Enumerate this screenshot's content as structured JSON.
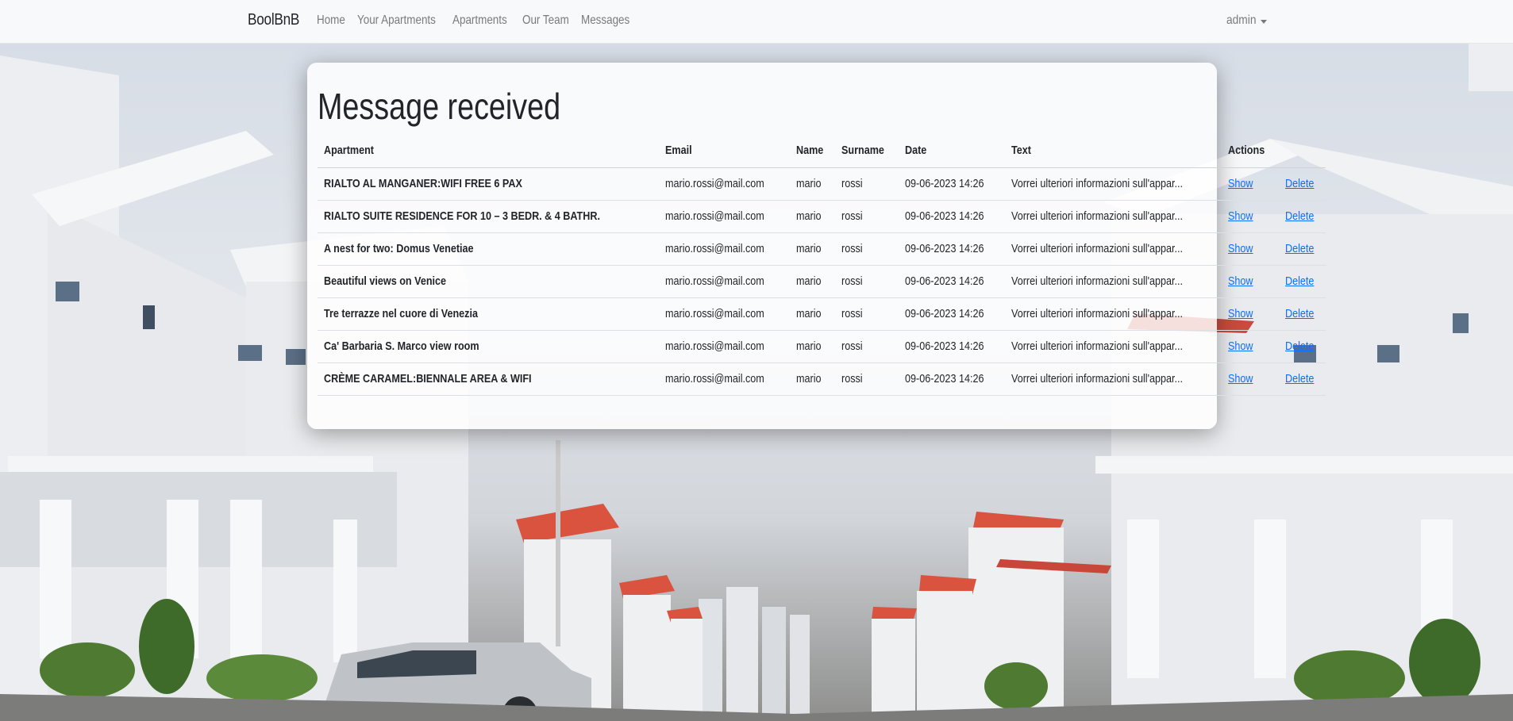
{
  "navbar": {
    "brand": "BoolBnB",
    "links": [
      "Home",
      "Your Apartments",
      "Apartments",
      "Our Team",
      "Messages"
    ],
    "user": "admin"
  },
  "page": {
    "title": "Message received"
  },
  "table": {
    "headers": [
      "Apartment",
      "Email",
      "Name",
      "Surname",
      "Date",
      "Text",
      "Actions"
    ],
    "rows": [
      {
        "apartment": "RIALTO AL MANGANER:WIFI FREE 6 PAX",
        "email": "mario.rossi@mail.com",
        "name": "mario",
        "surname": "rossi",
        "date": "09-06-2023 14:26",
        "text": "Vorrei ulteriori informazioni sull'appar...",
        "show": "Show",
        "delete": "Delete"
      },
      {
        "apartment": "RIALTO SUITE RESIDENCE FOR 10 – 3 BEDR. & 4 BATHR.",
        "email": "mario.rossi@mail.com",
        "name": "mario",
        "surname": "rossi",
        "date": "09-06-2023 14:26",
        "text": "Vorrei ulteriori informazioni sull'appar...",
        "show": "Show",
        "delete": "Delete"
      },
      {
        "apartment": "A nest for two: Domus Venetiae",
        "email": "mario.rossi@mail.com",
        "name": "mario",
        "surname": "rossi",
        "date": "09-06-2023 14:26",
        "text": "Vorrei ulteriori informazioni sull'appar...",
        "show": "Show",
        "delete": "Delete"
      },
      {
        "apartment": "Beautiful views on Venice",
        "email": "mario.rossi@mail.com",
        "name": "mario",
        "surname": "rossi",
        "date": "09-06-2023 14:26",
        "text": "Vorrei ulteriori informazioni sull'appar...",
        "show": "Show",
        "delete": "Delete"
      },
      {
        "apartment": "Tre terrazze nel cuore di Venezia",
        "email": "mario.rossi@mail.com",
        "name": "mario",
        "surname": "rossi",
        "date": "09-06-2023 14:26",
        "text": "Vorrei ulteriori informazioni sull'appar...",
        "show": "Show",
        "delete": "Delete"
      },
      {
        "apartment": "Ca' Barbaria S. Marco view room",
        "email": "mario.rossi@mail.com",
        "name": "mario",
        "surname": "rossi",
        "date": "09-06-2023 14:26",
        "text": "Vorrei ulteriori informazioni sull'appar...",
        "show": "Show",
        "delete": "Delete"
      },
      {
        "apartment": "CRÈME CARAMEL:BIENNALE AREA & WIFI",
        "email": "mario.rossi@mail.com",
        "name": "mario",
        "surname": "rossi",
        "date": "09-06-2023 14:26",
        "text": "Vorrei ulteriori informazioni sull'appar...",
        "show": "Show",
        "delete": "Delete"
      }
    ]
  },
  "colors": {
    "navbar_bg": "#f8f9fa",
    "link": "#0d6efd",
    "nav_text": "#7a7a7a",
    "roof_red": "#d9533f"
  }
}
